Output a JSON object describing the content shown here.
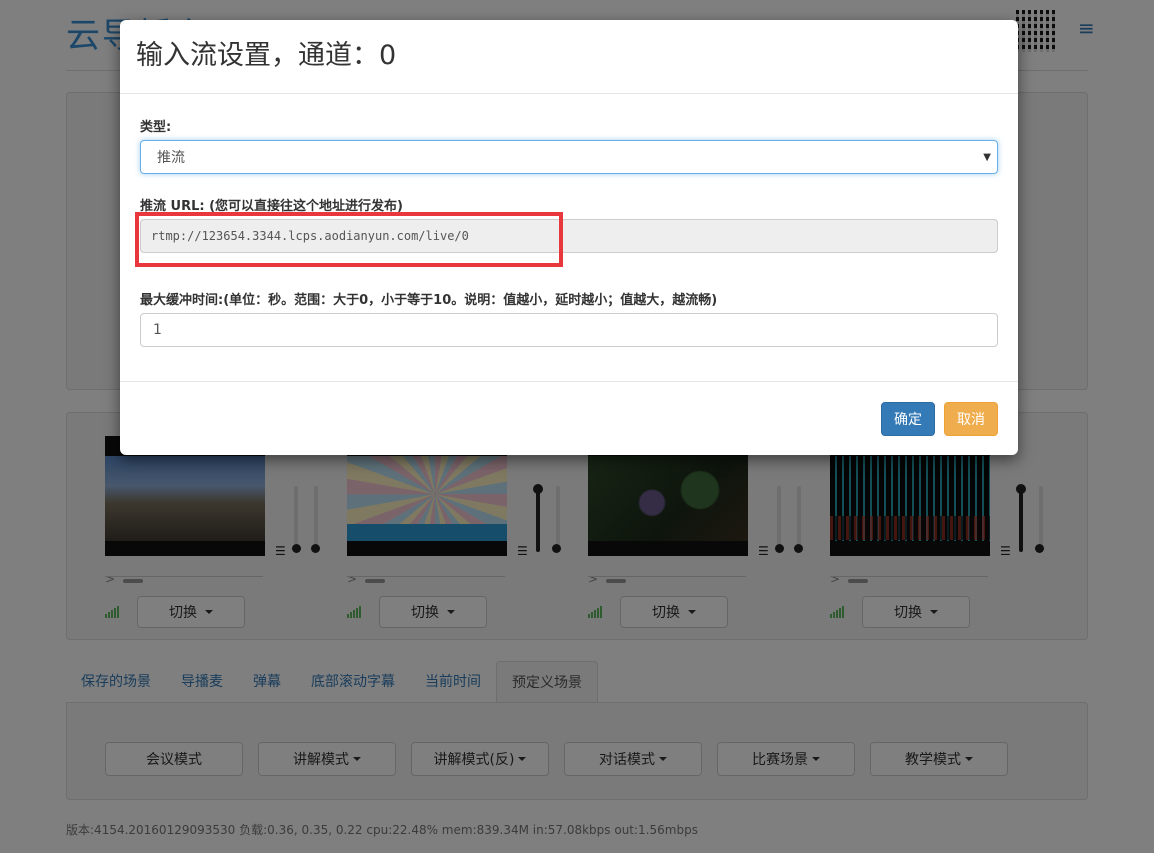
{
  "app": {
    "title": "云导播台"
  },
  "channels": [
    {
      "switch_label": "切换"
    },
    {
      "switch_label": "切换"
    },
    {
      "switch_label": "切换"
    },
    {
      "switch_label": "切换"
    }
  ],
  "tabs": [
    {
      "label": "保存的场景"
    },
    {
      "label": "导播麦"
    },
    {
      "label": "弹幕"
    },
    {
      "label": "底部滚动字幕"
    },
    {
      "label": "当前时间"
    },
    {
      "label": "预定义场景"
    }
  ],
  "presets": [
    {
      "label": "会议模式"
    },
    {
      "label": "讲解模式"
    },
    {
      "label": "讲解模式(反)"
    },
    {
      "label": "对话模式"
    },
    {
      "label": "比赛场景"
    },
    {
      "label": "教学模式"
    }
  ],
  "footer": {
    "status": "版本:4154.20160129093530 负载:0.36, 0.35, 0.22   cpu:22.48%   mem:839.34M   in:57.08kbps   out:1.56mbps"
  },
  "modal": {
    "title": "输入流设置，通道：0",
    "type_label": "类型:",
    "type_value": "推流",
    "url_label": "推流 URL: (您可以直接往这个地址进行发布)",
    "url_value": "rtmp://123654.3344.lcps.aodianyun.com/live/0",
    "buffer_label": "最大缓冲时间:(单位：秒。范围：大于0，小于等于10。说明：值越小，延时越小；值越大，越流畅)",
    "buffer_value": "1",
    "ok_label": "确定",
    "cancel_label": "取消"
  },
  "colors": {
    "primary": "#337ab7",
    "warning": "#f0ad4e",
    "highlight": "#e8383d",
    "link": "#337ab7"
  }
}
